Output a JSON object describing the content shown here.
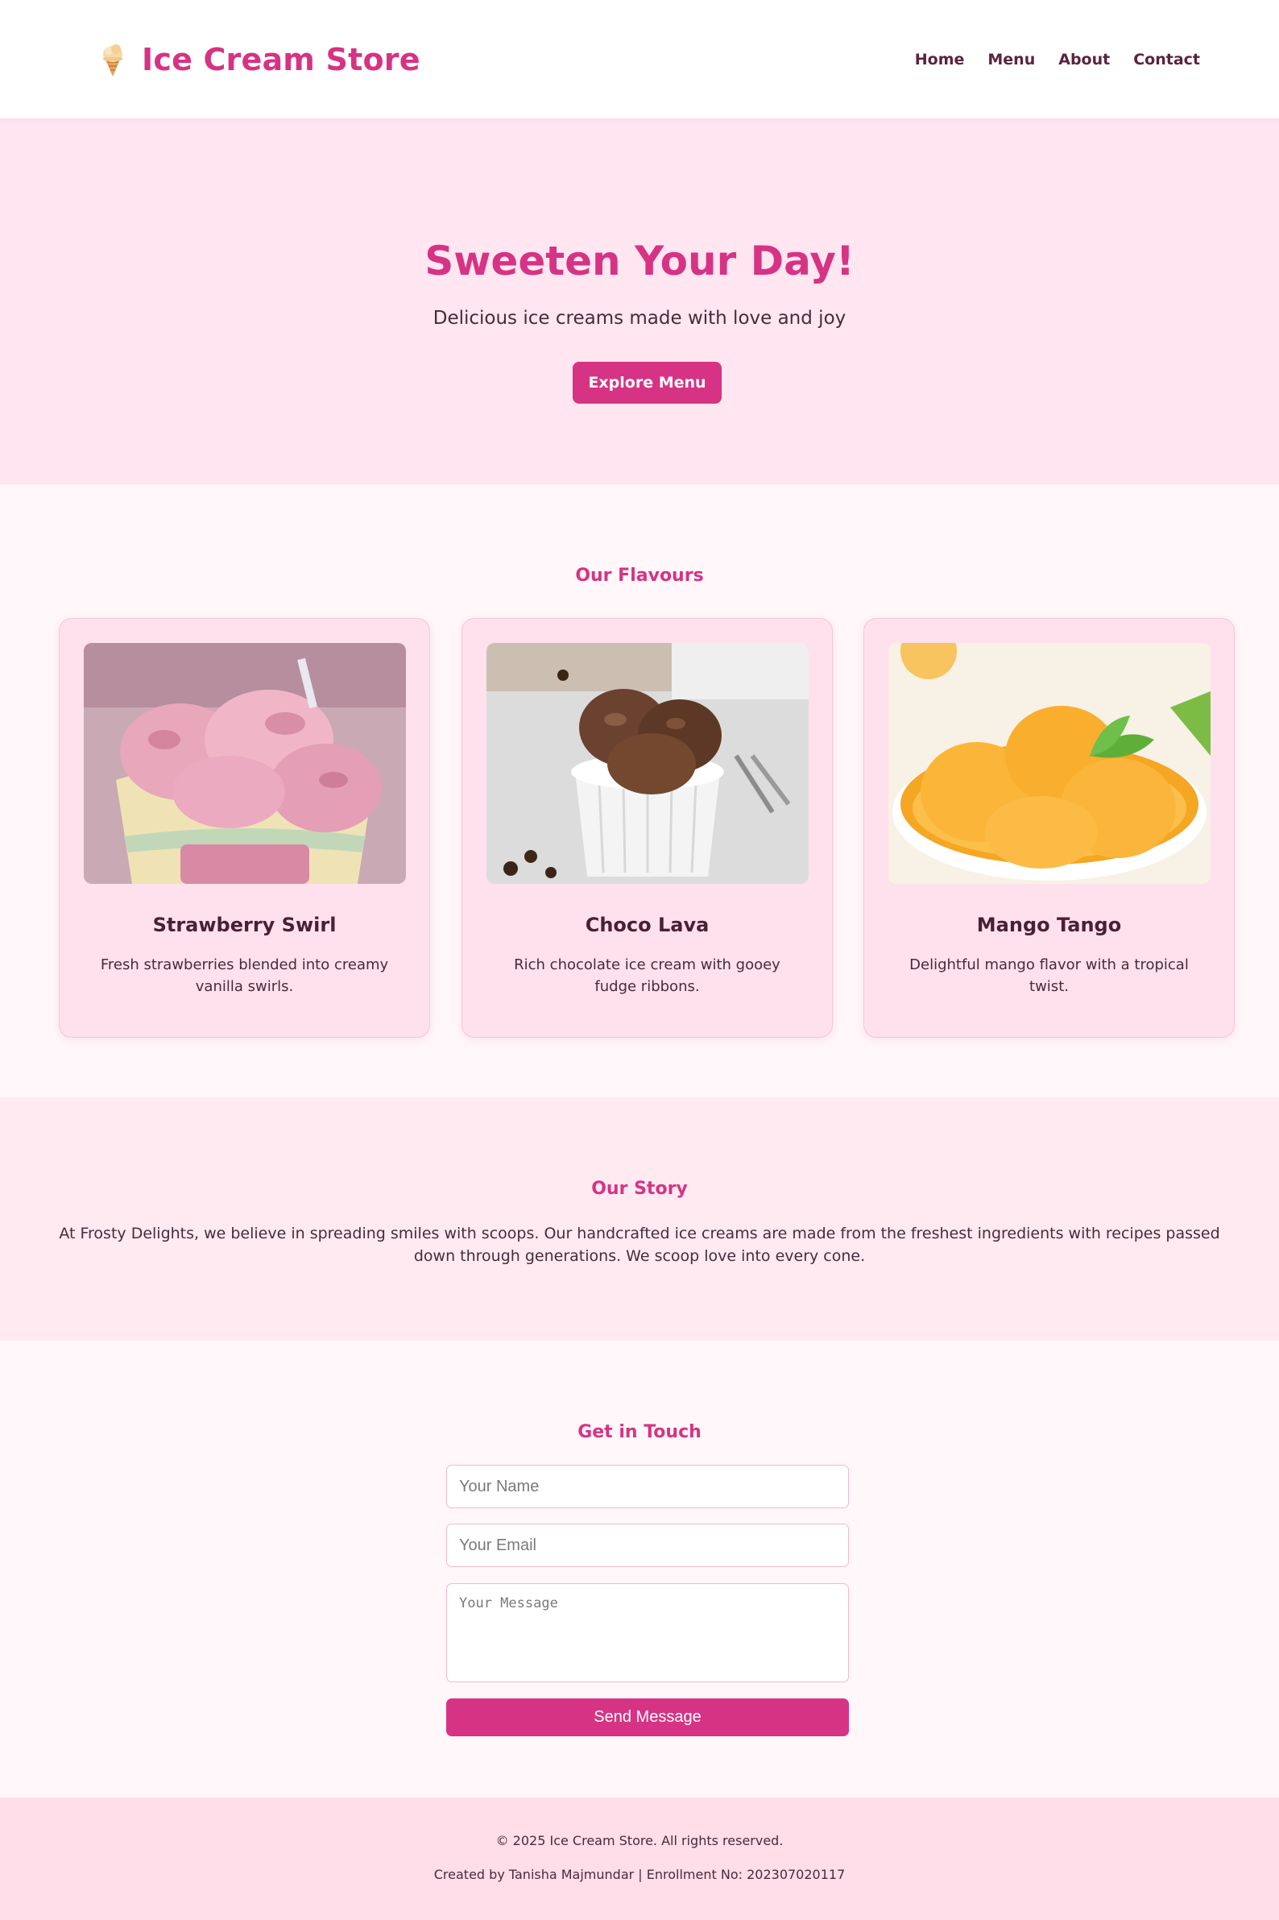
{
  "header": {
    "brand_icon": "ice-cream-cone-icon",
    "brand_title": "Ice Cream Store",
    "nav": [
      "Home",
      "Menu",
      "About",
      "Contact"
    ]
  },
  "hero": {
    "title": "Sweeten Your Day!",
    "subtitle": "Delicious ice creams made with love and joy",
    "cta_label": "Explore Menu"
  },
  "flavours": {
    "title": "Our Flavours",
    "items": [
      {
        "name": "Strawberry Swirl",
        "description": "Fresh strawberries blended into creamy vanilla swirls."
      },
      {
        "name": "Choco Lava",
        "description": "Rich chocolate ice cream with gooey fudge ribbons."
      },
      {
        "name": "Mango Tango",
        "description": "Delightful mango flavor with a tropical twist."
      }
    ]
  },
  "story": {
    "title": "Our Story",
    "text": "At Frosty Delights, we believe in spreading smiles with scoops. Our handcrafted ice creams are made from the freshest ingredients with recipes passed down through generations. We scoop love into every cone."
  },
  "contact": {
    "title": "Get in Touch",
    "name_placeholder": "Your Name",
    "email_placeholder": "Your Email",
    "message_placeholder": "Your Message",
    "send_label": "Send Message"
  },
  "footer": {
    "copyright": "© 2025 Ice Cream Store. All rights reserved.",
    "credit": "Created by Tanisha Majmundar | Enrollment No: 202307020117"
  },
  "colors": {
    "accent": "#d63384",
    "hero_bg": "#ffe6f0",
    "card_bg": "#ffe1ed",
    "footer_bg": "#ffdde9"
  }
}
